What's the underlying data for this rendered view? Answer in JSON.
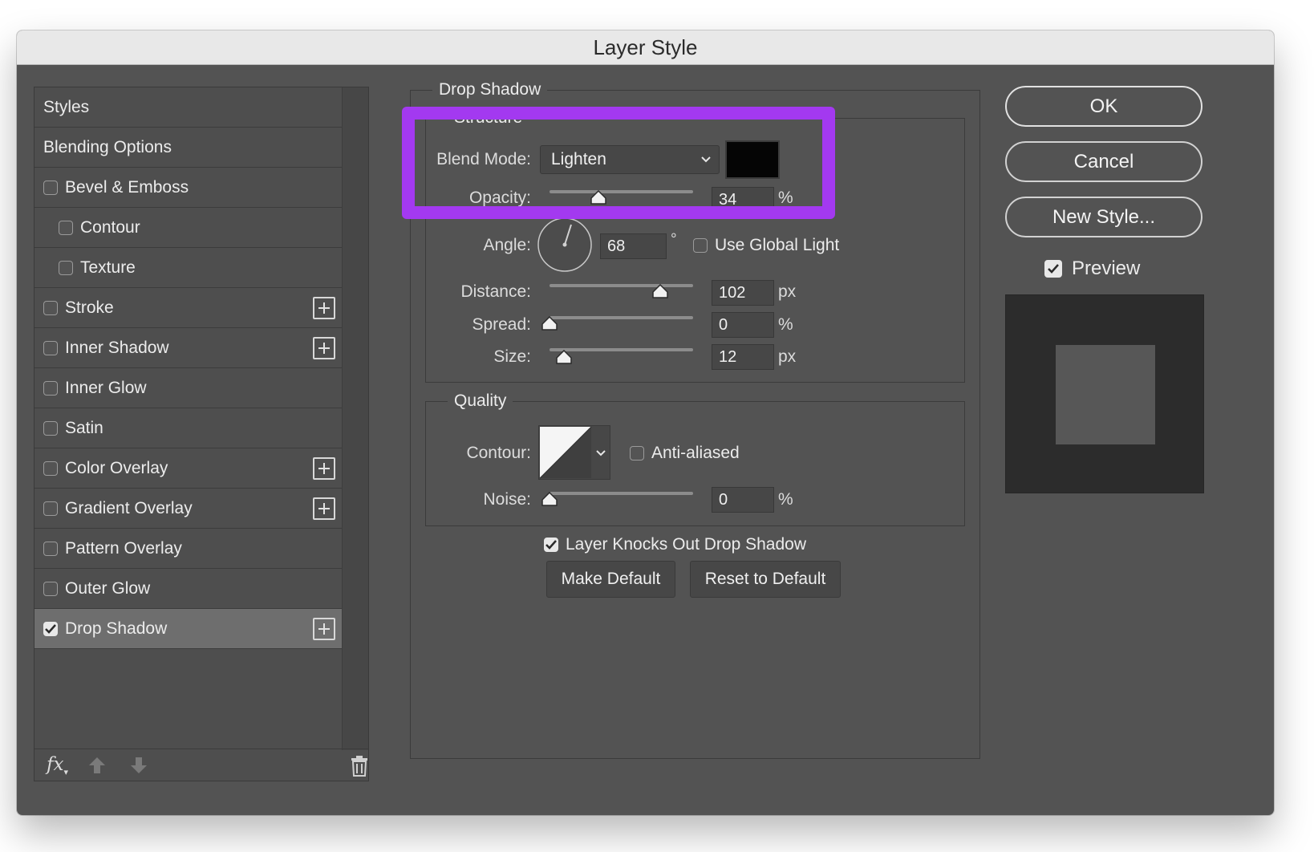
{
  "window": {
    "title": "Layer Style"
  },
  "styles_list": {
    "header": "Styles",
    "blending": "Blending Options",
    "items": [
      {
        "label": "Bevel & Emboss",
        "checked": false,
        "indent": false,
        "plus": false
      },
      {
        "label": "Contour",
        "checked": false,
        "indent": true,
        "plus": false
      },
      {
        "label": "Texture",
        "checked": false,
        "indent": true,
        "plus": false
      },
      {
        "label": "Stroke",
        "checked": false,
        "indent": false,
        "plus": true
      },
      {
        "label": "Inner Shadow",
        "checked": false,
        "indent": false,
        "plus": true
      },
      {
        "label": "Inner Glow",
        "checked": false,
        "indent": false,
        "plus": false
      },
      {
        "label": "Satin",
        "checked": false,
        "indent": false,
        "plus": false
      },
      {
        "label": "Color Overlay",
        "checked": false,
        "indent": false,
        "plus": true
      },
      {
        "label": "Gradient Overlay",
        "checked": false,
        "indent": false,
        "plus": true
      },
      {
        "label": "Pattern Overlay",
        "checked": false,
        "indent": false,
        "plus": false
      },
      {
        "label": "Outer Glow",
        "checked": false,
        "indent": false,
        "plus": false
      },
      {
        "label": "Drop Shadow",
        "checked": true,
        "indent": false,
        "plus": true,
        "selected": true
      }
    ],
    "footer": {
      "fx_label": "fx",
      "icons": [
        "fx-icon",
        "arrow-up-icon",
        "arrow-down-icon",
        "trash-icon"
      ]
    }
  },
  "drop_shadow": {
    "legend": "Drop Shadow",
    "structure": {
      "legend": "Structure",
      "blend_mode_label": "Blend Mode:",
      "blend_mode_value": "Lighten",
      "shadow_color": "#050505",
      "opacity_label": "Opacity:",
      "opacity_value": "34",
      "opacity_unit": "%",
      "opacity_level": 0.34,
      "angle_label": "Angle:",
      "angle_value": "68",
      "angle_unit": "°",
      "global_light_label": "Use Global Light",
      "global_light_checked": false,
      "distance_label": "Distance:",
      "distance_value": "102",
      "distance_unit": "px",
      "spread_label": "Spread:",
      "spread_value": "0",
      "spread_unit": "%",
      "spread_level": 0,
      "size_label": "Size:",
      "size_value": "12",
      "size_unit": "px"
    },
    "quality": {
      "legend": "Quality",
      "contour_label": "Contour:",
      "anti_aliased_label": "Anti-aliased",
      "anti_aliased_checked": false,
      "noise_label": "Noise:",
      "noise_value": "0",
      "noise_unit": "%",
      "noise_level": 0
    },
    "knockout_label": "Layer Knocks Out Drop Shadow",
    "knockout_checked": true,
    "make_default": "Make Default",
    "reset_default": "Reset to Default"
  },
  "actions": {
    "ok": "OK",
    "cancel": "Cancel",
    "new_style": "New Style...",
    "preview_label": "Preview",
    "preview_checked": true
  },
  "colors": {
    "highlight": "#a339f0",
    "dialog_bg": "#535353"
  }
}
